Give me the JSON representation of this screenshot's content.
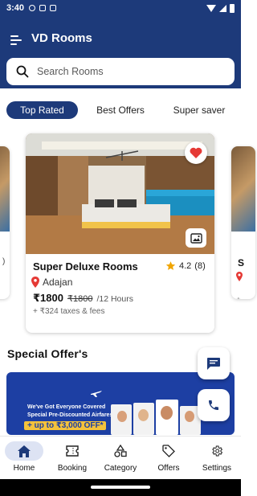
{
  "status_bar": {
    "time": "3:40"
  },
  "app": {
    "title": "VD Rooms"
  },
  "search": {
    "placeholder": "Search Rooms",
    "value": ""
  },
  "tabs": [
    {
      "label": "Top Rated",
      "active": true
    },
    {
      "label": "Best Offers",
      "active": false
    },
    {
      "label": "Super saver",
      "active": false
    }
  ],
  "room_card": {
    "name": "Super Deluxe Rooms",
    "rating": "4.2",
    "reviews": "(8)",
    "location": "Adajan",
    "price": "₹1800",
    "old_price": "₹1800",
    "duration": "/12 Hours",
    "taxes": "+ ₹324 taxes & fees",
    "favorite": true,
    "icons": {
      "favorite": "heart-icon",
      "gallery": "image-gallery-icon",
      "location": "location-pin-icon",
      "rating": "star-icon"
    }
  },
  "side_cards": {
    "right_name_fragment": "S",
    "right_taxes_fragment": "+",
    "left_taxes_fragment": ")"
  },
  "section": {
    "special_offers_title": "Special Offer's"
  },
  "offer_banner": {
    "line1": "We've Got Everyone Covered",
    "line2": "Special Pre-Discounted Airfares",
    "line3": "+ up to ₹3,000 OFF*"
  },
  "fabs": {
    "chat": "chat-icon",
    "call": "phone-icon"
  },
  "bottom_nav": [
    {
      "label": "Home",
      "icon": "home-icon",
      "active": true
    },
    {
      "label": "Booking",
      "icon": "ticket-icon",
      "active": false
    },
    {
      "label": "Category",
      "icon": "category-icon",
      "active": false
    },
    {
      "label": "Offers",
      "icon": "tag-icon",
      "active": false
    },
    {
      "label": "Settings",
      "icon": "gear-icon",
      "active": false
    }
  ],
  "colors": {
    "primary": "#1d3a7a",
    "favorite": "#e53935",
    "rating_star": "#f0a500",
    "location_pin": "#e53935",
    "banner": "#1d3fa3"
  }
}
